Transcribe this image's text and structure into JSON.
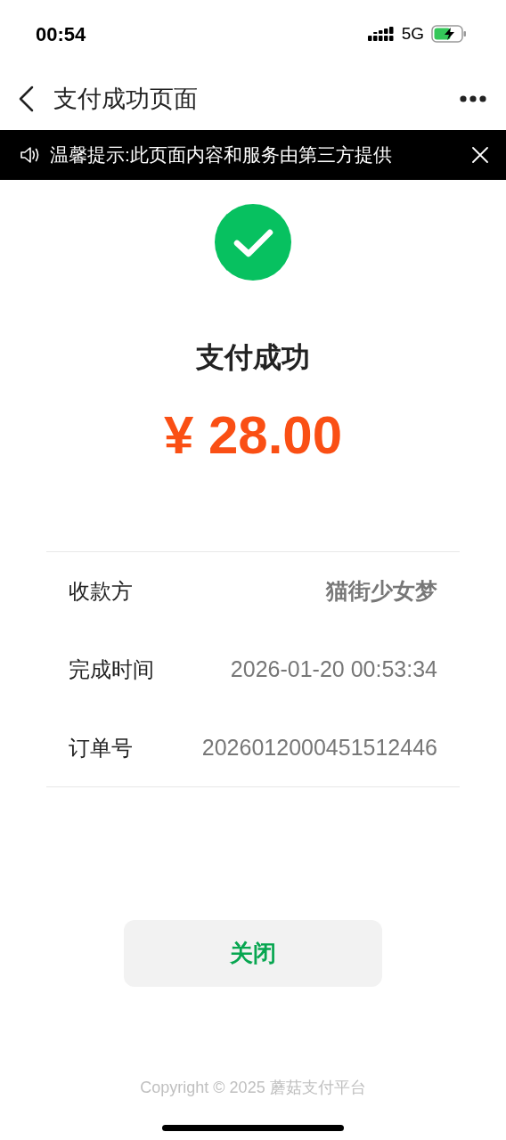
{
  "status_bar": {
    "time": "00:54",
    "network": "5G"
  },
  "nav": {
    "title": "支付成功页面"
  },
  "notice": {
    "text": "温馨提示:此页面内容和服务由第三方提供"
  },
  "result": {
    "title": "支付成功",
    "amount": "¥ 28.00"
  },
  "details": [
    {
      "label": "收款方",
      "value": "猫街少女梦",
      "bold": true
    },
    {
      "label": "完成时间",
      "value": "2026-01-20 00:53:34",
      "bold": false
    },
    {
      "label": "订单号",
      "value": "2026012000451512446",
      "bold": false
    }
  ],
  "close_button": "关闭",
  "footer": "Copyright © 2025 蘑菇支付平台"
}
